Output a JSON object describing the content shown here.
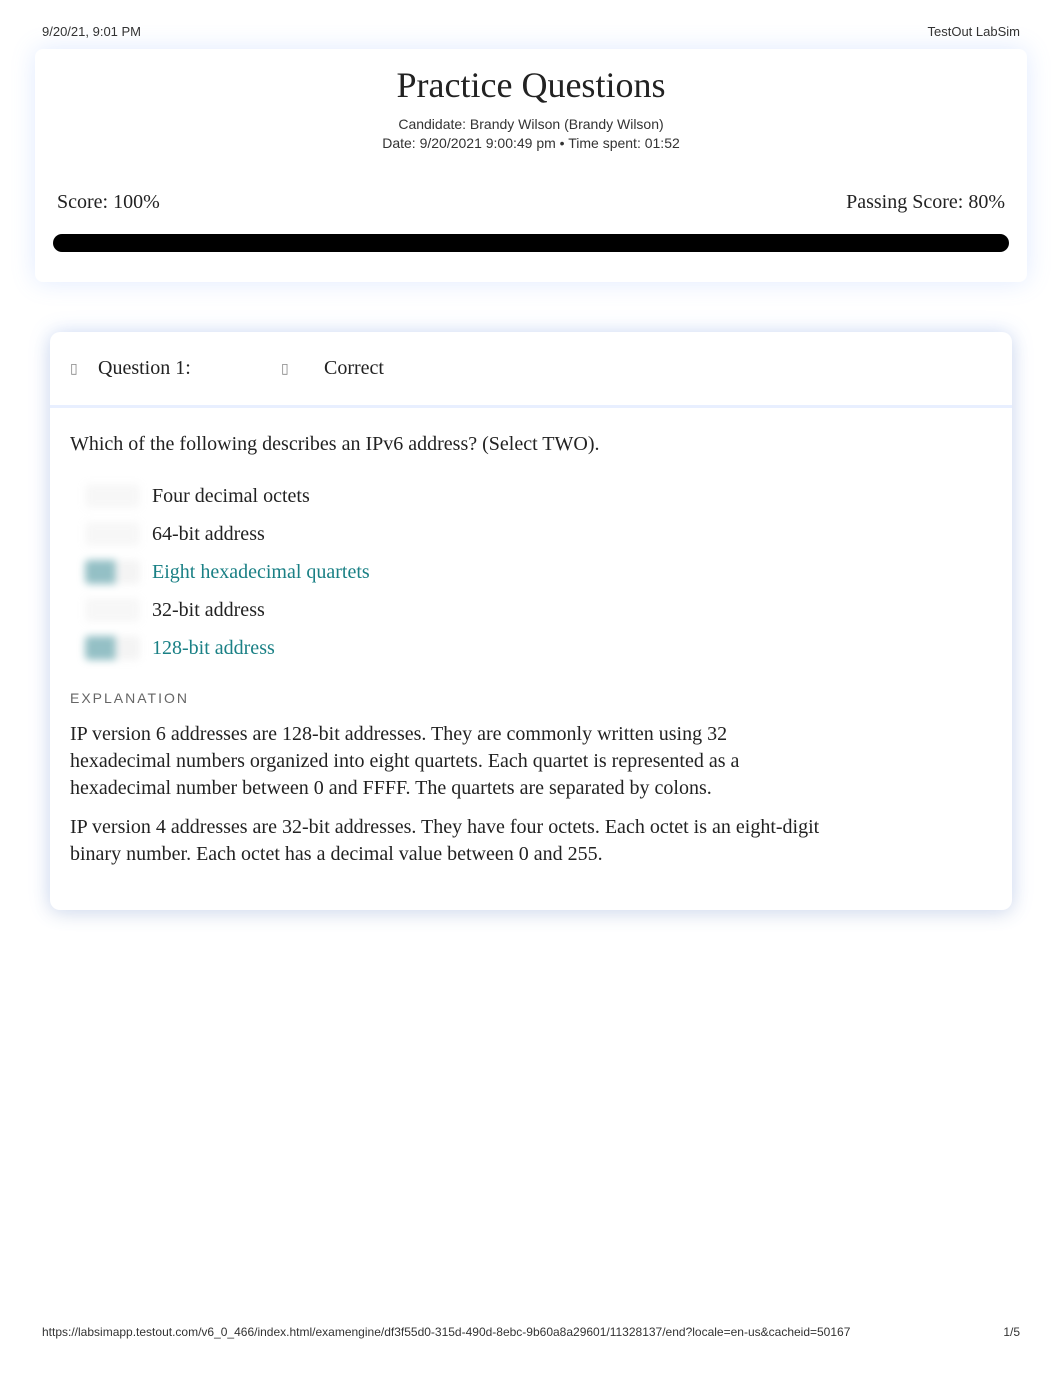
{
  "header": {
    "timestamp": "9/20/21, 9:01 PM",
    "app_name": "TestOut LabSim"
  },
  "title": "Practice Questions",
  "candidate_line": "Candidate: Brandy Wilson (Brandy Wilson)",
  "date_line": "Date: 9/20/2021 9:00:49 pm • Time spent: 01:52",
  "score": {
    "label": "Score: 100%",
    "passing": "Passing Score: 80%"
  },
  "question": {
    "label": "Question 1:",
    "status": "Correct",
    "text": "Which of the following describes an IPv6 address? (Select TWO).",
    "answers": [
      {
        "text": "Four decimal octets",
        "correct": false
      },
      {
        "text": "64-bit address",
        "correct": false
      },
      {
        "text": "Eight hexadecimal quartets",
        "correct": true
      },
      {
        "text": "32-bit address",
        "correct": false
      },
      {
        "text": "128-bit address",
        "correct": true
      }
    ],
    "explanation_label": "EXPLANATION",
    "explanation": [
      "IP version 6 addresses are 128-bit addresses. They are commonly written using 32 hexadecimal numbers organized into eight quartets. Each quartet is represented as a hexadecimal number between 0 and FFFF. The quartets are separated by colons.",
      "IP version 4 addresses are 32-bit addresses. They have four octets. Each octet is an eight-digit binary number. Each octet has a decimal value between 0 and 255."
    ]
  },
  "footer": {
    "url": "https://labsimapp.testout.com/v6_0_466/index.html/examengine/df3f55d0-315d-490d-8ebc-9b60a8a29601/11328137/end?locale=en-us&cacheid=50167",
    "page": "1/5"
  }
}
